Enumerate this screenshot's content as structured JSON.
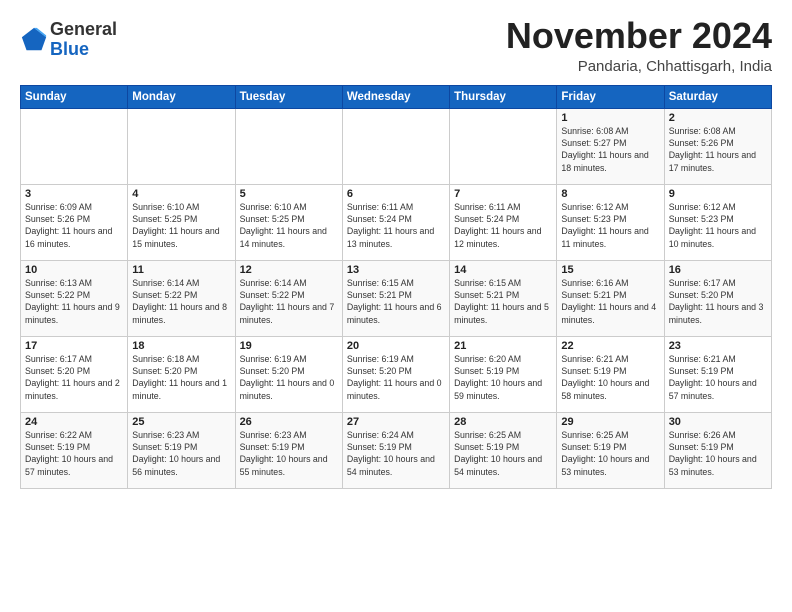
{
  "header": {
    "logo_general": "General",
    "logo_blue": "Blue",
    "month_title": "November 2024",
    "subtitle": "Pandaria, Chhattisgarh, India"
  },
  "days_of_week": [
    "Sunday",
    "Monday",
    "Tuesday",
    "Wednesday",
    "Thursday",
    "Friday",
    "Saturday"
  ],
  "weeks": [
    [
      {
        "day": "",
        "info": ""
      },
      {
        "day": "",
        "info": ""
      },
      {
        "day": "",
        "info": ""
      },
      {
        "day": "",
        "info": ""
      },
      {
        "day": "",
        "info": ""
      },
      {
        "day": "1",
        "info": "Sunrise: 6:08 AM\nSunset: 5:27 PM\nDaylight: 11 hours and 18 minutes."
      },
      {
        "day": "2",
        "info": "Sunrise: 6:08 AM\nSunset: 5:26 PM\nDaylight: 11 hours and 17 minutes."
      }
    ],
    [
      {
        "day": "3",
        "info": "Sunrise: 6:09 AM\nSunset: 5:26 PM\nDaylight: 11 hours and 16 minutes."
      },
      {
        "day": "4",
        "info": "Sunrise: 6:10 AM\nSunset: 5:25 PM\nDaylight: 11 hours and 15 minutes."
      },
      {
        "day": "5",
        "info": "Sunrise: 6:10 AM\nSunset: 5:25 PM\nDaylight: 11 hours and 14 minutes."
      },
      {
        "day": "6",
        "info": "Sunrise: 6:11 AM\nSunset: 5:24 PM\nDaylight: 11 hours and 13 minutes."
      },
      {
        "day": "7",
        "info": "Sunrise: 6:11 AM\nSunset: 5:24 PM\nDaylight: 11 hours and 12 minutes."
      },
      {
        "day": "8",
        "info": "Sunrise: 6:12 AM\nSunset: 5:23 PM\nDaylight: 11 hours and 11 minutes."
      },
      {
        "day": "9",
        "info": "Sunrise: 6:12 AM\nSunset: 5:23 PM\nDaylight: 11 hours and 10 minutes."
      }
    ],
    [
      {
        "day": "10",
        "info": "Sunrise: 6:13 AM\nSunset: 5:22 PM\nDaylight: 11 hours and 9 minutes."
      },
      {
        "day": "11",
        "info": "Sunrise: 6:14 AM\nSunset: 5:22 PM\nDaylight: 11 hours and 8 minutes."
      },
      {
        "day": "12",
        "info": "Sunrise: 6:14 AM\nSunset: 5:22 PM\nDaylight: 11 hours and 7 minutes."
      },
      {
        "day": "13",
        "info": "Sunrise: 6:15 AM\nSunset: 5:21 PM\nDaylight: 11 hours and 6 minutes."
      },
      {
        "day": "14",
        "info": "Sunrise: 6:15 AM\nSunset: 5:21 PM\nDaylight: 11 hours and 5 minutes."
      },
      {
        "day": "15",
        "info": "Sunrise: 6:16 AM\nSunset: 5:21 PM\nDaylight: 11 hours and 4 minutes."
      },
      {
        "day": "16",
        "info": "Sunrise: 6:17 AM\nSunset: 5:20 PM\nDaylight: 11 hours and 3 minutes."
      }
    ],
    [
      {
        "day": "17",
        "info": "Sunrise: 6:17 AM\nSunset: 5:20 PM\nDaylight: 11 hours and 2 minutes."
      },
      {
        "day": "18",
        "info": "Sunrise: 6:18 AM\nSunset: 5:20 PM\nDaylight: 11 hours and 1 minute."
      },
      {
        "day": "19",
        "info": "Sunrise: 6:19 AM\nSunset: 5:20 PM\nDaylight: 11 hours and 0 minutes."
      },
      {
        "day": "20",
        "info": "Sunrise: 6:19 AM\nSunset: 5:20 PM\nDaylight: 11 hours and 0 minutes."
      },
      {
        "day": "21",
        "info": "Sunrise: 6:20 AM\nSunset: 5:19 PM\nDaylight: 10 hours and 59 minutes."
      },
      {
        "day": "22",
        "info": "Sunrise: 6:21 AM\nSunset: 5:19 PM\nDaylight: 10 hours and 58 minutes."
      },
      {
        "day": "23",
        "info": "Sunrise: 6:21 AM\nSunset: 5:19 PM\nDaylight: 10 hours and 57 minutes."
      }
    ],
    [
      {
        "day": "24",
        "info": "Sunrise: 6:22 AM\nSunset: 5:19 PM\nDaylight: 10 hours and 57 minutes."
      },
      {
        "day": "25",
        "info": "Sunrise: 6:23 AM\nSunset: 5:19 PM\nDaylight: 10 hours and 56 minutes."
      },
      {
        "day": "26",
        "info": "Sunrise: 6:23 AM\nSunset: 5:19 PM\nDaylight: 10 hours and 55 minutes."
      },
      {
        "day": "27",
        "info": "Sunrise: 6:24 AM\nSunset: 5:19 PM\nDaylight: 10 hours and 54 minutes."
      },
      {
        "day": "28",
        "info": "Sunrise: 6:25 AM\nSunset: 5:19 PM\nDaylight: 10 hours and 54 minutes."
      },
      {
        "day": "29",
        "info": "Sunrise: 6:25 AM\nSunset: 5:19 PM\nDaylight: 10 hours and 53 minutes."
      },
      {
        "day": "30",
        "info": "Sunrise: 6:26 AM\nSunset: 5:19 PM\nDaylight: 10 hours and 53 minutes."
      }
    ]
  ]
}
